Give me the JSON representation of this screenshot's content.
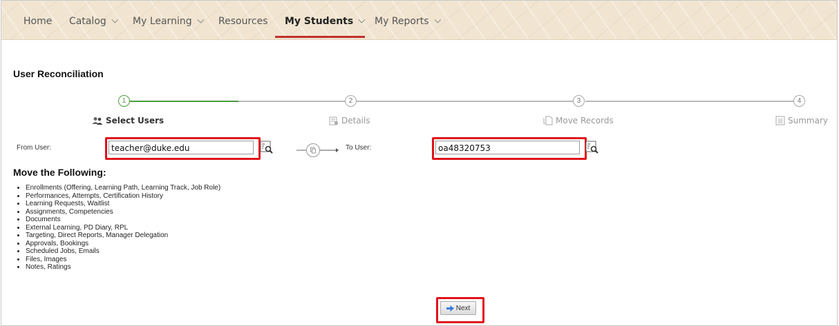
{
  "nav": {
    "items": [
      {
        "label": "Home",
        "has_menu": false,
        "active": false
      },
      {
        "label": "Catalog",
        "has_menu": true,
        "active": false
      },
      {
        "label": "My Learning",
        "has_menu": true,
        "active": false
      },
      {
        "label": "Resources",
        "has_menu": false,
        "active": false
      },
      {
        "label": "My Students",
        "has_menu": true,
        "active": true
      },
      {
        "label": "My Reports",
        "has_menu": true,
        "active": false
      }
    ],
    "accent_color": "#c0302b"
  },
  "page": {
    "title": "User Reconciliation"
  },
  "stepper": {
    "steps": [
      {
        "number": "1",
        "label": "Select Users",
        "icon": "users-icon",
        "active": true
      },
      {
        "number": "2",
        "label": "Details",
        "icon": "details-icon",
        "active": false
      },
      {
        "number": "3",
        "label": "Move Records",
        "icon": "move-records-icon",
        "active": false
      },
      {
        "number": "4",
        "label": "Summary",
        "icon": "summary-icon",
        "active": false
      }
    ],
    "active_color": "#4a9a3c"
  },
  "form": {
    "from_label": "From User:",
    "from_value": "teacher@duke.edu",
    "to_label": "To User:",
    "to_value": "oa48320753"
  },
  "move": {
    "title": "Move the Following:",
    "items": [
      "Enrollments (Offering, Learning Path, Learning Track, Job Role)",
      "Performances, Attempts, Certification History",
      "Learning Requests, Waitlist",
      "Assignments, Competencies",
      "Documents",
      "External Learning, PD Diary, RPL",
      "Targeting, Direct Reports, Manager Delegation",
      "Approvals, Bookings",
      "Scheduled Jobs, Emails",
      "Files, Images",
      "Notes, Ratings"
    ]
  },
  "actions": {
    "next_label": "Next"
  },
  "highlight_color": "#e0111c"
}
